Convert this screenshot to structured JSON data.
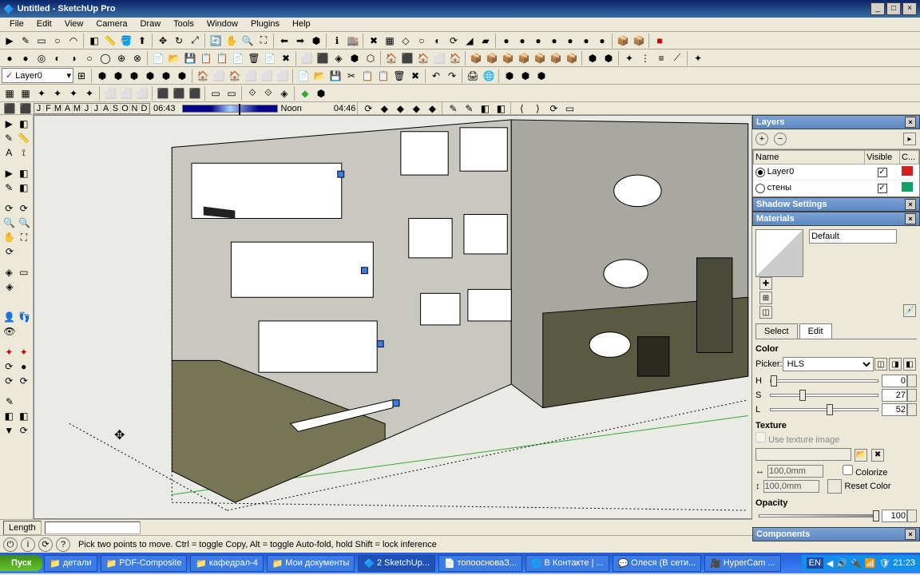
{
  "title": "Untitled - SketchUp Pro",
  "menus": [
    "File",
    "Edit",
    "View",
    "Camera",
    "Draw",
    "Tools",
    "Window",
    "Plugins",
    "Help"
  ],
  "layer_dropdown": "Layer0",
  "time": {
    "months": [
      "J",
      "F",
      "M",
      "A",
      "M",
      "J",
      "J",
      "A",
      "S",
      "O",
      "N",
      "D"
    ],
    "t1": "06:43",
    "noon": "Noon",
    "t2": "04:46"
  },
  "layers_panel": {
    "title": "Layers",
    "cols": {
      "name": "Name",
      "visible": "Visible",
      "c": "C..."
    },
    "rows": [
      {
        "name": "Layer0",
        "visible": true,
        "color": "#d42020",
        "active": true
      },
      {
        "name": "стены",
        "visible": true,
        "color": "#12a068",
        "active": false
      }
    ]
  },
  "shadow_panel": {
    "title": "Shadow Settings"
  },
  "materials": {
    "title": "Materials",
    "name": "Default",
    "tabs": {
      "select": "Select",
      "edit": "Edit"
    },
    "color_lbl": "Color",
    "picker_lbl": "Picker:",
    "picker_val": "HLS",
    "h": {
      "lbl": "H",
      "val": "0"
    },
    "s": {
      "lbl": "S",
      "val": "27"
    },
    "l": {
      "lbl": "L",
      "val": "52"
    },
    "texture_lbl": "Texture",
    "use_tex": "Use texture image",
    "dim": "100,0mm",
    "colorize": "Colorize",
    "reset": "Reset Color",
    "opacity_lbl": "Opacity",
    "opacity_val": "100"
  },
  "components": {
    "title": "Components"
  },
  "status": {
    "length": "Length"
  },
  "hint": "Pick two points to move.  Ctrl = toggle Copy, Alt = toggle Auto-fold, hold Shift = lock inference",
  "taskbar": {
    "start": "Пуск",
    "tasks": [
      {
        "label": "детали",
        "icon": "📁"
      },
      {
        "label": "PDF-Composite",
        "icon": "📁"
      },
      {
        "label": "кафедрал-4",
        "icon": "📁"
      },
      {
        "label": "Мои документы",
        "icon": "📁"
      },
      {
        "label": "2 SketchUp...",
        "icon": "🔷",
        "active": true
      },
      {
        "label": "топоосноваЗ...",
        "icon": "📄"
      },
      {
        "label": "В Контакте | ...",
        "icon": "🌐"
      },
      {
        "label": "Олеся (В сети...",
        "icon": "💬"
      },
      {
        "label": "HyperCam ...",
        "icon": "🎥"
      }
    ],
    "lang": "EN",
    "clock": "21:23"
  }
}
